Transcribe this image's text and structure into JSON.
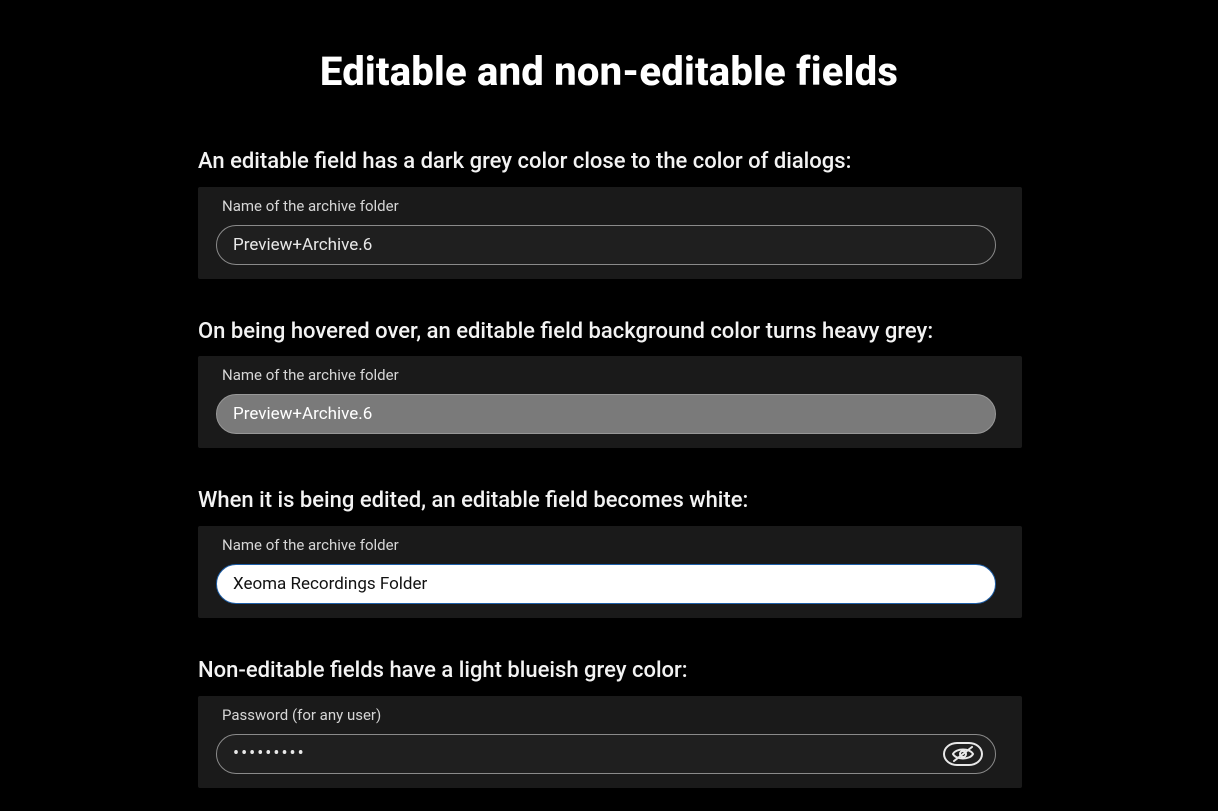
{
  "title": "Editable and non-editable fields",
  "sections": {
    "default": {
      "caption": "An editable field has a dark grey color close to the color of dialogs:",
      "label": "Name of the archive folder",
      "value": "Preview+Archive.6"
    },
    "hovered": {
      "caption": "On being hovered over, an editable field background color turns heavy grey:",
      "label": "Name of the archive folder",
      "value": "Preview+Archive.6"
    },
    "editing": {
      "caption": "When it is being edited, an editable field becomes white:",
      "label": "Name of the archive folder",
      "value": "Xeoma Recordings Folder"
    },
    "readonly": {
      "caption": "Non-editable fields have a light blueish grey color:",
      "label": "Password (for any user)",
      "value": "•••••••••"
    }
  }
}
